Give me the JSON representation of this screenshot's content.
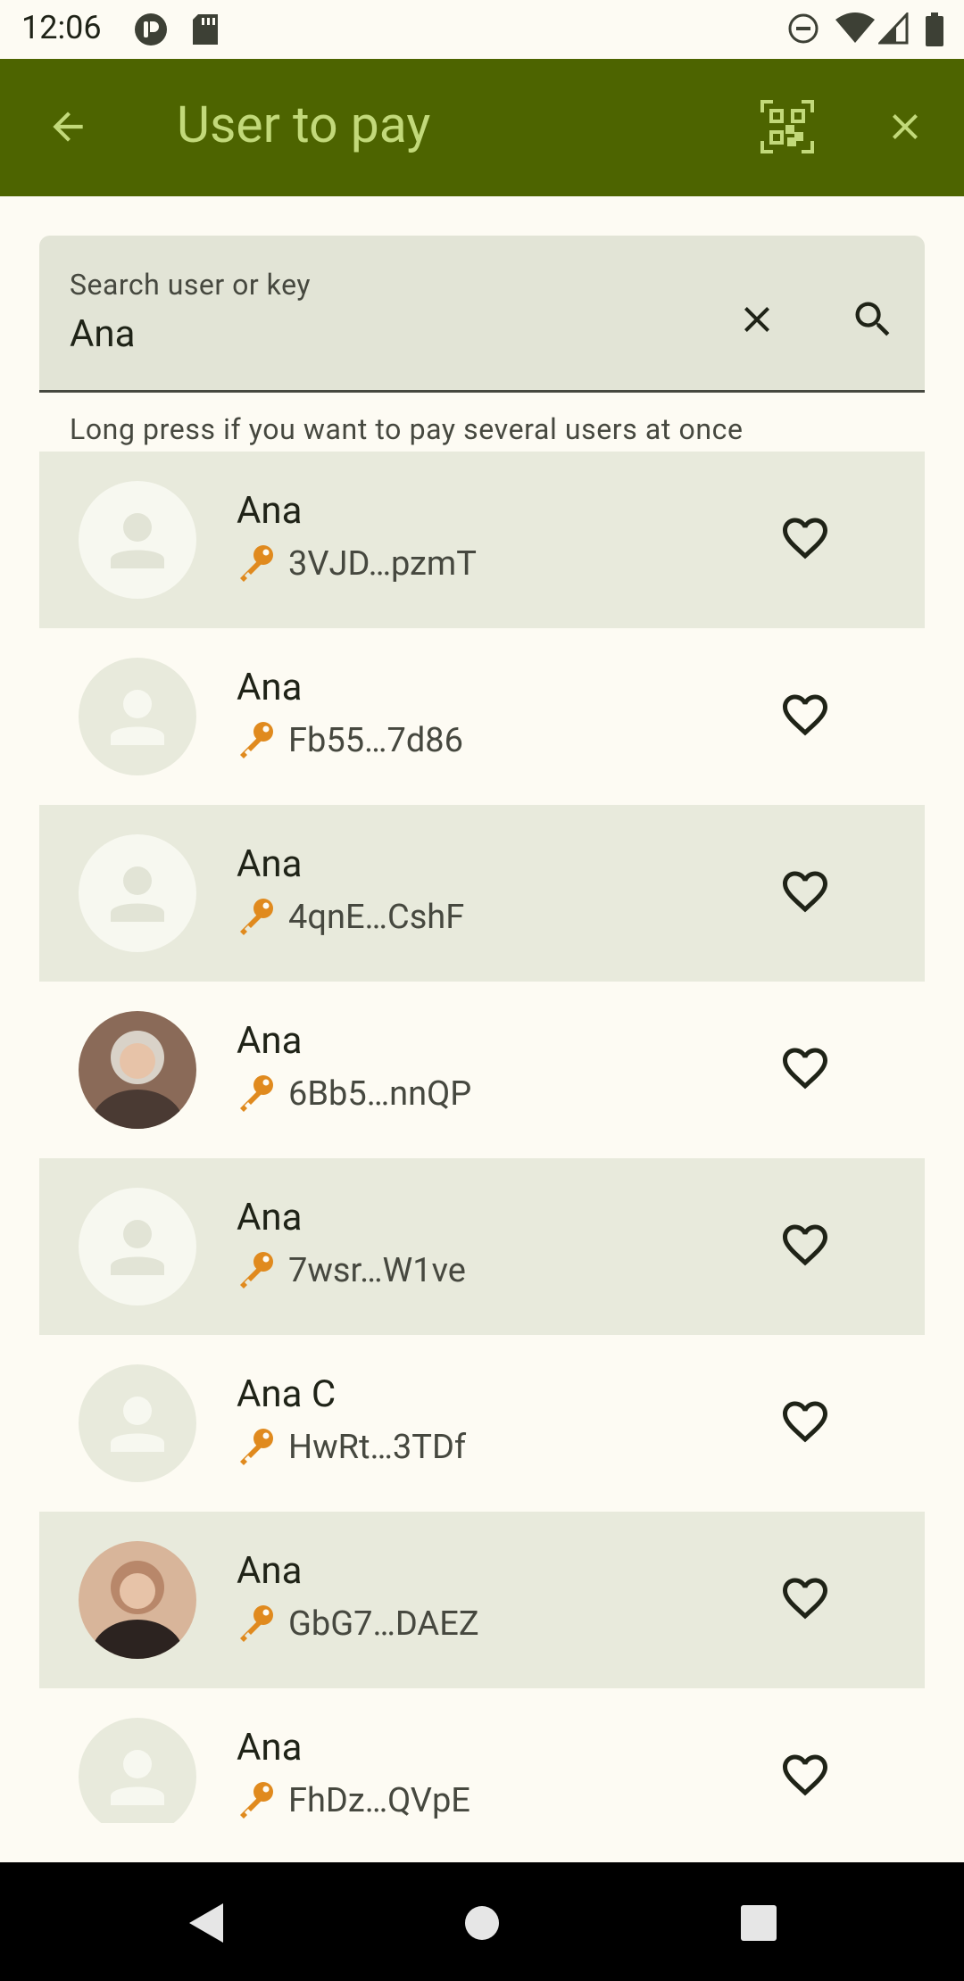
{
  "status_bar": {
    "time": "12:06",
    "left_icons": [
      "app-notification-icon",
      "sd-card-icon"
    ],
    "right_icons": [
      "dnd-icon",
      "wifi-icon",
      "signal-icon",
      "battery-icon"
    ]
  },
  "app_bar": {
    "title": "User to pay",
    "back_icon": "arrow-back-icon",
    "qr_icon": "qr-scan-icon",
    "close_icon": "close-icon",
    "background_color": "#4d6400",
    "title_color": "#c2d97a"
  },
  "search": {
    "label": "Search user or key",
    "value": "Ana",
    "clear_icon": "clear-icon",
    "search_icon": "search-icon"
  },
  "hint": "Long press if you want to pay several users at once",
  "users": [
    {
      "name": "Ana",
      "key": "3VJD…pzmT",
      "avatar": "placeholder",
      "shaded": true
    },
    {
      "name": "Ana",
      "key": "Fb55…7d86",
      "avatar": "placeholder",
      "shaded": false
    },
    {
      "name": "Ana",
      "key": "4qnE…CshF",
      "avatar": "placeholder",
      "shaded": true
    },
    {
      "name": "Ana",
      "key": "6Bb5…nnQP",
      "avatar": "photo",
      "shaded": false
    },
    {
      "name": "Ana",
      "key": "7wsr…W1ve",
      "avatar": "placeholder",
      "shaded": true
    },
    {
      "name": "Ana C",
      "key": "HwRt…3TDf",
      "avatar": "placeholder",
      "shaded": false
    },
    {
      "name": "Ana",
      "key": "GbG7…DAEZ",
      "avatar": "photo",
      "shaded": true
    },
    {
      "name": "Ana",
      "key": "FhDz…QVpE",
      "avatar": "placeholder",
      "shaded": false
    }
  ],
  "row_icons": {
    "key": "key-icon",
    "favorite": "heart-outline-icon"
  },
  "colors": {
    "key_icon": "#e08a1e",
    "row_shade": "#e8eadc",
    "background": "#fdfbf3"
  },
  "nav_bar": {
    "icons": [
      "nav-back-icon",
      "nav-home-icon",
      "nav-recents-icon"
    ]
  }
}
